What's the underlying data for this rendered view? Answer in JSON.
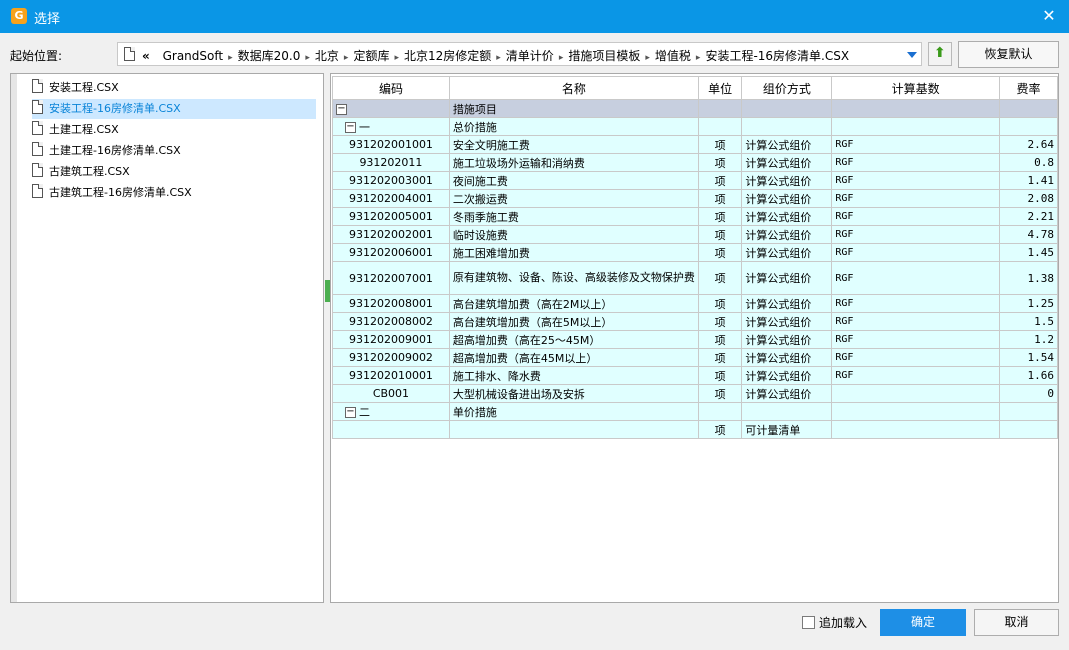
{
  "window": {
    "title": "选择",
    "app_icon_glyph": "G",
    "close_glyph": "✕",
    "accent_color": "#0a96e6"
  },
  "location": {
    "label": "起始位置:",
    "back_glyph": "«",
    "breadcrumbs": [
      "GrandSoft",
      "数据库20.0",
      "北京",
      "定额库",
      "北京12房修定额",
      "清单计价",
      "措施项目模板",
      "增值税",
      "安装工程-16房修清单.CSX"
    ],
    "separator": "▸",
    "up_button_icon": "folder-up-icon",
    "restore_label": "恢复默认"
  },
  "files": [
    {
      "name": "安装工程.CSX",
      "selected": false
    },
    {
      "name": "安装工程-16房修清单.CSX",
      "selected": true
    },
    {
      "name": "土建工程.CSX",
      "selected": false
    },
    {
      "name": "土建工程-16房修清单.CSX",
      "selected": false
    },
    {
      "name": "古建筑工程.CSX",
      "selected": false
    },
    {
      "name": "古建筑工程-16房修清单.CSX",
      "selected": false
    }
  ],
  "table": {
    "headers": [
      "编码",
      "名称",
      "单位",
      "组价方式",
      "计算基数",
      "费率"
    ],
    "rows": [
      {
        "type": "root",
        "code": "",
        "toggle": "−",
        "label": "",
        "name": "措施项目",
        "unit": "",
        "method": "",
        "base": "",
        "rate": ""
      },
      {
        "type": "group",
        "code": "",
        "toggle": "−",
        "label": "一",
        "name": "总价措施",
        "unit": "",
        "method": "",
        "base": "",
        "rate": ""
      },
      {
        "type": "item",
        "code": "931202001001",
        "name": "安全文明施工费",
        "unit": "项",
        "method": "计算公式组价",
        "base": "RGF",
        "rate": "2.64"
      },
      {
        "type": "item",
        "code": "931202011",
        "name": "施工垃圾场外运输和消纳费",
        "unit": "项",
        "method": "计算公式组价",
        "base": "RGF",
        "rate": "0.8"
      },
      {
        "type": "item",
        "code": "931202003001",
        "name": "夜间施工费",
        "unit": "项",
        "method": "计算公式组价",
        "base": "RGF",
        "rate": "1.41"
      },
      {
        "type": "item",
        "code": "931202004001",
        "name": "二次搬运费",
        "unit": "项",
        "method": "计算公式组价",
        "base": "RGF",
        "rate": "2.08"
      },
      {
        "type": "item",
        "code": "931202005001",
        "name": "冬雨季施工费",
        "unit": "项",
        "method": "计算公式组价",
        "base": "RGF",
        "rate": "2.21"
      },
      {
        "type": "item",
        "code": "931202002001",
        "name": "临时设施费",
        "unit": "项",
        "method": "计算公式组价",
        "base": "RGF",
        "rate": "4.78"
      },
      {
        "type": "item",
        "code": "931202006001",
        "name": "施工困难增加费",
        "unit": "项",
        "method": "计算公式组价",
        "base": "RGF",
        "rate": "1.45"
      },
      {
        "type": "item",
        "tall": true,
        "code": "931202007001",
        "name": "原有建筑物、设备、陈设、高级装修及文物保护费",
        "unit": "项",
        "method": "计算公式组价",
        "base": "RGF",
        "rate": "1.38"
      },
      {
        "type": "item",
        "code": "931202008001",
        "name": "高台建筑增加费（高在2M以上）",
        "unit": "项",
        "method": "计算公式组价",
        "base": "RGF",
        "rate": "1.25"
      },
      {
        "type": "item",
        "code": "931202008002",
        "name": "高台建筑增加费（高在5M以上）",
        "unit": "项",
        "method": "计算公式组价",
        "base": "RGF",
        "rate": "1.5"
      },
      {
        "type": "item",
        "code": "931202009001",
        "name": "超高增加费（高在25～45M）",
        "unit": "项",
        "method": "计算公式组价",
        "base": "RGF",
        "rate": "1.2"
      },
      {
        "type": "item",
        "code": "931202009002",
        "name": "超高增加费（高在45M以上）",
        "unit": "项",
        "method": "计算公式组价",
        "base": "RGF",
        "rate": "1.54"
      },
      {
        "type": "item",
        "code": "931202010001",
        "name": "施工排水、降水费",
        "unit": "项",
        "method": "计算公式组价",
        "base": "RGF",
        "rate": "1.66"
      },
      {
        "type": "item",
        "code": "CB001",
        "name": "大型机械设备进出场及安拆",
        "unit": "项",
        "method": "计算公式组价",
        "base": "",
        "rate": "0"
      },
      {
        "type": "group",
        "code": "",
        "toggle": "−",
        "label": "二",
        "name": "单价措施",
        "unit": "",
        "method": "",
        "base": "",
        "rate": ""
      },
      {
        "type": "item",
        "code": "",
        "name": "",
        "unit": "项",
        "method": "可计量清单",
        "base": "",
        "rate": ""
      }
    ]
  },
  "footer": {
    "append_label": "追加载入",
    "append_checked": false,
    "ok_label": "确定",
    "cancel_label": "取消",
    "ok_color": "#1e8fe6"
  }
}
